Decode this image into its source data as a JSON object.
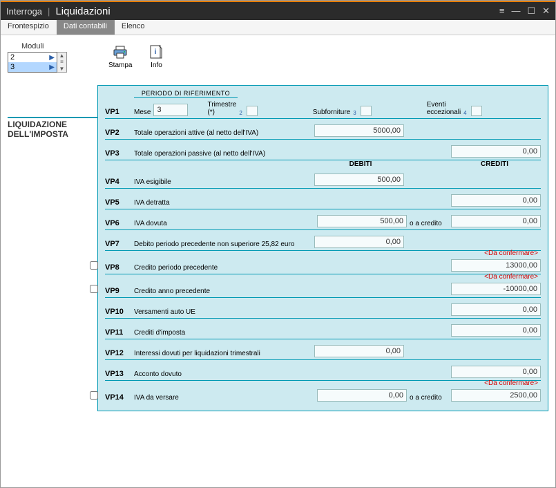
{
  "window": {
    "mode": "Interroga",
    "title": "Liquidazioni"
  },
  "tabs": [
    "Frontespizio",
    "Dati contabili",
    "Elenco"
  ],
  "activeTab": 1,
  "moduli": {
    "label": "Moduli",
    "items": [
      "2",
      "3"
    ],
    "selected": 1
  },
  "toolbar": {
    "print": "Stampa",
    "info": "Info"
  },
  "side": {
    "label1": "LIQUIDAZIONE",
    "label2": "DELL'IMPOSTA"
  },
  "headers": {
    "periodo": "PERIODO DI RIFERIMENTO",
    "debiti": "DEBITI",
    "crediti": "CREDITI"
  },
  "vp1": {
    "code": "VP1",
    "meseLabel": "Mese",
    "meseVal": "3",
    "trimLabel": "Trimestre (*)",
    "subfLabel": "Subforniture",
    "eventiLabel": "Eventi eccezionali",
    "n2": "2",
    "n3": "3",
    "n4": "4"
  },
  "vp2": {
    "code": "VP2",
    "desc": "Totale operazioni attive (al netto dell'IVA)",
    "val": "5000,00"
  },
  "vp3": {
    "code": "VP3",
    "desc": "Totale operazioni passive (al netto dell'IVA)",
    "val": "0,00"
  },
  "vp4": {
    "code": "VP4",
    "desc": "IVA esigibile",
    "deb": "500,00"
  },
  "vp5": {
    "code": "VP5",
    "desc": "IVA detratta",
    "cred": "0,00"
  },
  "vp6": {
    "code": "VP6",
    "desc": "IVA dovuta",
    "deb": "500,00",
    "mid": "o a credito",
    "cred": "0,00"
  },
  "vp7": {
    "code": "VP7",
    "desc": "Debito periodo precedente non superiore 25,82 euro",
    "deb": "0,00"
  },
  "vp8": {
    "code": "VP8",
    "desc": "Credito periodo precedente",
    "cred": "13000,00",
    "note": "<Da confermare>"
  },
  "vp9": {
    "code": "VP9",
    "desc": "Credito anno precedente",
    "cred": "-10000,00",
    "note": "<Da confermare>"
  },
  "vp10": {
    "code": "VP10",
    "desc": "Versamenti auto UE",
    "cred": "0,00"
  },
  "vp11": {
    "code": "VP11",
    "desc": "Crediti d'imposta",
    "cred": "0,00"
  },
  "vp12": {
    "code": "VP12",
    "desc": "Interessi dovuti per liquidazioni trimestrali",
    "deb": "0,00"
  },
  "vp13": {
    "code": "VP13",
    "desc": "Acconto dovuto",
    "cred": "0,00"
  },
  "vp14": {
    "code": "VP14",
    "desc": "IVA da versare",
    "deb": "0,00",
    "mid": "o a credito",
    "cred": "2500,00",
    "note": "<Da confermare>"
  }
}
